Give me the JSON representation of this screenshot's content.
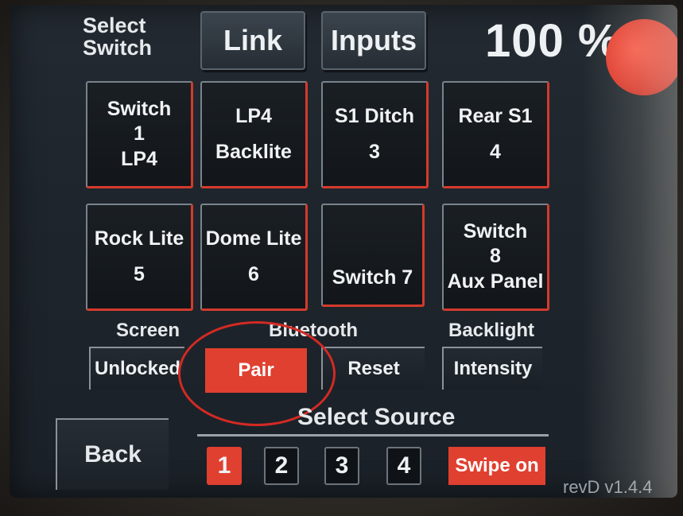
{
  "header": {
    "select_switch_line1": "Select",
    "select_switch_line2": "Switch",
    "link_label": "Link",
    "inputs_label": "Inputs",
    "brightness": "100 %"
  },
  "tiles": [
    {
      "lines": [
        "Switch",
        "1",
        "LP4"
      ]
    },
    {
      "lines": [
        "LP4",
        "Backlite"
      ]
    },
    {
      "lines": [
        "S1 Ditch",
        "3"
      ]
    },
    {
      "lines": [
        "Rear S1",
        "4"
      ]
    },
    {
      "lines": [
        "Rock Lite",
        "5"
      ]
    },
    {
      "lines": [
        "Dome Lite",
        "6"
      ]
    },
    {
      "lines": [
        "Switch 7"
      ]
    },
    {
      "lines": [
        "Switch",
        "8",
        "Aux Panel"
      ]
    }
  ],
  "controls": {
    "screen_label": "Screen",
    "screen_value": "Unlocked",
    "bluetooth_label": "Bluetooth",
    "pair_label": "Pair",
    "reset_label": "Reset",
    "backlight_label": "Backlight",
    "intensity_label": "Intensity"
  },
  "source": {
    "title": "Select Source",
    "options": [
      "1",
      "2",
      "3",
      "4"
    ],
    "selected": "1",
    "swipe_label": "Swipe on"
  },
  "back_label": "Back",
  "version": "revD v1.4.4",
  "colors": {
    "accent_red": "#e04030",
    "screen_bg": "#1e252c",
    "text": "#eef1f3"
  }
}
